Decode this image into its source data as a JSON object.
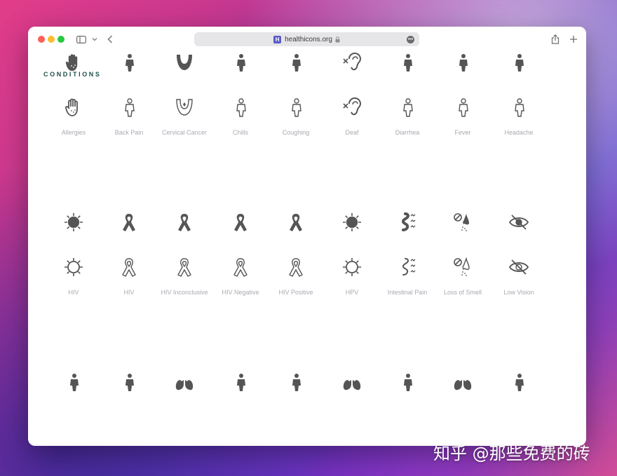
{
  "browser": {
    "url": "healthicons.org",
    "favicon_letter": "H"
  },
  "section": {
    "title": "CONDITIONS"
  },
  "rows": [
    {
      "items": [
        {
          "label": "Allergies",
          "icon": "allergies-hand-icon"
        },
        {
          "label": "Back Pain",
          "icon": "back-pain-icon"
        },
        {
          "label": "Cervical Cancer",
          "icon": "cervical-cancer-icon"
        },
        {
          "label": "Chills",
          "icon": "chills-icon"
        },
        {
          "label": "Coughing",
          "icon": "coughing-icon"
        },
        {
          "label": "Deaf",
          "icon": "deaf-ear-icon"
        },
        {
          "label": "Diarrhea",
          "icon": "diarrhea-icon"
        },
        {
          "label": "Fever",
          "icon": "fever-icon"
        },
        {
          "label": "Headache",
          "icon": "headache-icon"
        }
      ]
    },
    {
      "items": [
        {
          "label": "HIV",
          "icon": "hiv-virus-icon"
        },
        {
          "label": "HIV",
          "icon": "hiv-ribbon-icon"
        },
        {
          "label": "HIV Inconclusive",
          "icon": "hiv-inconclusive-ribbon-icon"
        },
        {
          "label": "HIV Negative",
          "icon": "hiv-negative-ribbon-icon"
        },
        {
          "label": "HIV Positive",
          "icon": "hiv-positive-ribbon-icon"
        },
        {
          "label": "HPV",
          "icon": "hpv-virus-icon"
        },
        {
          "label": "Intestinal Pain",
          "icon": "intestinal-pain-icon"
        },
        {
          "label": "Loss of Smell",
          "icon": "loss-of-smell-icon"
        },
        {
          "label": "Low Vision",
          "icon": "low-vision-eye-icon"
        }
      ]
    },
    {
      "items": [
        {
          "label": "",
          "icon": "person-stomach-pain-icon"
        },
        {
          "label": "",
          "icon": "obesity-icon"
        },
        {
          "label": "",
          "icon": "lungs-spots-icon"
        },
        {
          "label": "",
          "icon": "person-pain-icon"
        },
        {
          "label": "",
          "icon": "person-sneeze-icon"
        },
        {
          "label": "",
          "icon": "lungs-icon"
        },
        {
          "label": "",
          "icon": "person-standing-icon"
        },
        {
          "label": "",
          "icon": "lungs-virus-icon"
        },
        {
          "label": "",
          "icon": "person-vomiting-icon"
        }
      ]
    }
  ],
  "watermark": "知乎 @那些免费的砖",
  "colors": {
    "icon": "#555555",
    "section_title": "#1d4f4a",
    "label": "#a9aab2"
  }
}
